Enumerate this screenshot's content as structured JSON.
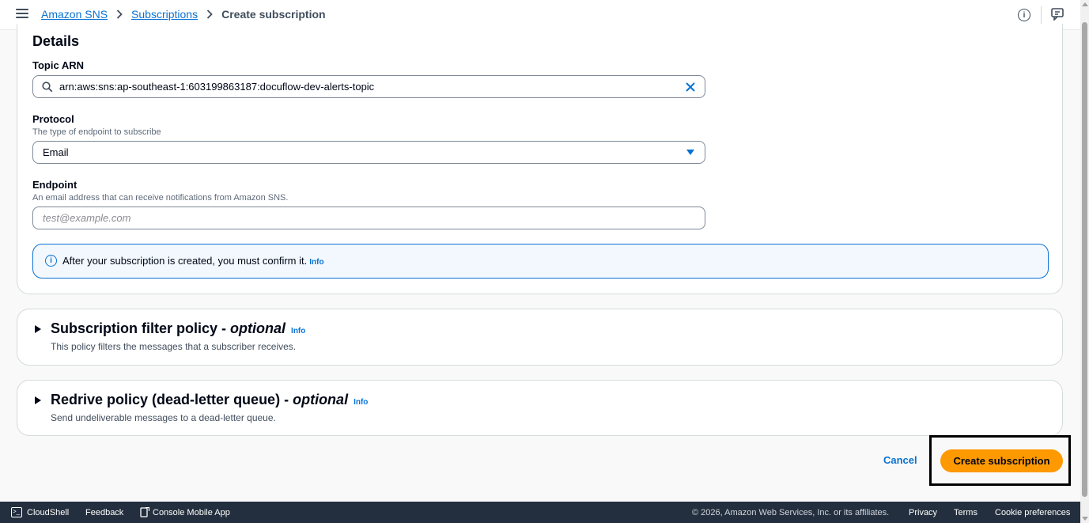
{
  "breadcrumb": {
    "items": [
      "Amazon SNS",
      "Subscriptions"
    ],
    "current": "Create subscription"
  },
  "details": {
    "title": "Details",
    "topic_arn": {
      "label": "Topic ARN",
      "value": "arn:aws:sns:ap-southeast-1:603199863187:docuflow-dev-alerts-topic"
    },
    "protocol": {
      "label": "Protocol",
      "description": "The type of endpoint to subscribe",
      "value": "Email"
    },
    "endpoint": {
      "label": "Endpoint",
      "description": "An email address that can receive notifications from Amazon SNS.",
      "placeholder": "test@example.com"
    },
    "alert": {
      "text": "After your subscription is created, you must confirm it.",
      "info": "Info"
    }
  },
  "filter_policy": {
    "title": "Subscription filter policy -",
    "optional": "optional",
    "info": "Info",
    "description": "This policy filters the messages that a subscriber receives."
  },
  "redrive_policy": {
    "title": "Redrive policy (dead-letter queue) -",
    "optional": "optional",
    "info": "Info",
    "description": "Send undeliverable messages to a dead-letter queue."
  },
  "actions": {
    "cancel": "Cancel",
    "create": "Create subscription"
  },
  "footer": {
    "cloudshell": "CloudShell",
    "feedback": "Feedback",
    "mobile_app": "Console Mobile App",
    "copyright": "© 2026, Amazon Web Services, Inc. or its affiliates.",
    "privacy": "Privacy",
    "terms": "Terms",
    "cookies": "Cookie preferences"
  },
  "icons": {
    "menu": "hamburger-menu-icon",
    "info": "info-icon",
    "feedback": "feedback-icon",
    "search": "search-icon",
    "clear": "close-icon",
    "caret": "caret-down-icon",
    "expand": "caret-right-icon",
    "cloudshell": "terminal-icon",
    "mobile": "mobile-app-icon"
  },
  "colors": {
    "accent": "#0972d3",
    "primary_button": "#ff9900",
    "footer_bg": "#232f3e"
  }
}
